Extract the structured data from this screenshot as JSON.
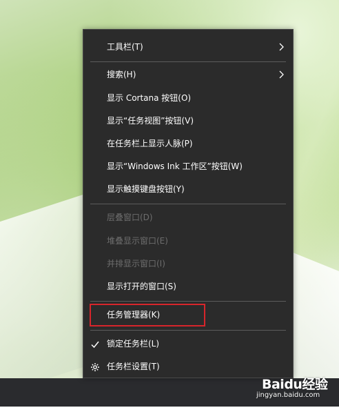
{
  "context_menu": {
    "items": [
      {
        "label": "工具栏(T)",
        "has_submenu": true,
        "enabled": true
      },
      {
        "label": "搜索(H)",
        "has_submenu": true,
        "enabled": true
      },
      {
        "label": "显示 Cortana 按钮(O)",
        "enabled": true
      },
      {
        "label": "显示“任务视图”按钮(V)",
        "enabled": true
      },
      {
        "label": "在任务栏上显示人脉(P)",
        "enabled": true
      },
      {
        "label": "显示“Windows Ink 工作区”按钮(W)",
        "enabled": true
      },
      {
        "label": "显示触摸键盘按钮(Y)",
        "enabled": true
      },
      {
        "label": "层叠窗口(D)",
        "enabled": false
      },
      {
        "label": "堆叠显示窗口(E)",
        "enabled": false
      },
      {
        "label": "并排显示窗口(I)",
        "enabled": false
      },
      {
        "label": "显示打开的窗口(S)",
        "enabled": true
      },
      {
        "label": "任务管理器(K)",
        "enabled": true,
        "highlighted": true
      },
      {
        "label": "锁定任务栏(L)",
        "checked": true,
        "enabled": true
      },
      {
        "label": "任务栏设置(T)",
        "icon": "gear-icon",
        "enabled": true
      }
    ]
  },
  "highlight_color": "#d8252b",
  "menu_background": "#2b2b2b",
  "watermark": {
    "brand": "Baidu经验",
    "url": "jingyan.baidu.com"
  }
}
